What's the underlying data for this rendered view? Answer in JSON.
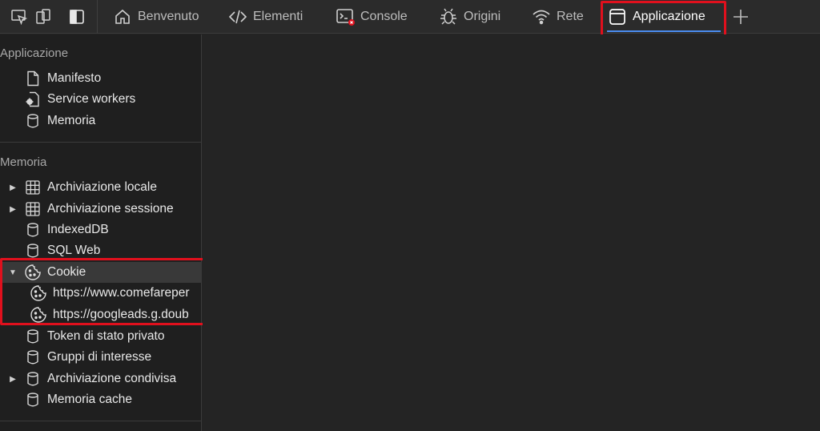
{
  "toolbar": {
    "icons": [
      "inspect-element-icon",
      "device-emulation-icon",
      "toggle-sidebar-icon"
    ]
  },
  "tabs": [
    {
      "label": "Benvenuto",
      "icon": "home-icon"
    },
    {
      "label": "Elementi",
      "icon": "code-icon"
    },
    {
      "label": "Console",
      "icon": "console-icon"
    },
    {
      "label": "Origini",
      "icon": "bug-icon"
    },
    {
      "label": "Rete",
      "icon": "wifi-icon"
    },
    {
      "label": "Applicazione",
      "icon": "window-icon",
      "active": true
    }
  ],
  "add_tab_icon": "plus-icon",
  "sidebar": {
    "application": {
      "title": "Applicazione",
      "items": [
        {
          "label": "Manifesto",
          "icon": "file-icon"
        },
        {
          "label": "Service workers",
          "icon": "gear-file-icon"
        },
        {
          "label": "Memoria",
          "icon": "database-icon"
        }
      ]
    },
    "storage": {
      "title": "Memoria",
      "items": [
        {
          "label": "Archiviazione locale",
          "icon": "grid-icon",
          "expandable": true
        },
        {
          "label": "Archiviazione sessione",
          "icon": "grid-icon",
          "expandable": true
        },
        {
          "label": "IndexedDB",
          "icon": "database-icon"
        },
        {
          "label": "SQL Web",
          "icon": "database-icon"
        },
        {
          "label": "Cookie",
          "icon": "cookie-icon",
          "expanded": true,
          "selected": true
        },
        {
          "label": "https://www.comefareper",
          "icon": "cookie-icon",
          "child": true
        },
        {
          "label": "https://googleads.g.doub",
          "icon": "cookie-icon",
          "child": true
        },
        {
          "label": "Token di stato privato",
          "icon": "database-icon"
        },
        {
          "label": "Gruppi di interesse",
          "icon": "database-icon"
        },
        {
          "label": "Archiviazione condivisa",
          "icon": "database-icon",
          "expandable": true
        },
        {
          "label": "Memoria cache",
          "icon": "database-icon"
        }
      ]
    }
  },
  "colors": {
    "highlight": "#e0101d",
    "accent": "#4a8cf0",
    "background": "#242424",
    "sidebar": "#1f1f1f"
  }
}
